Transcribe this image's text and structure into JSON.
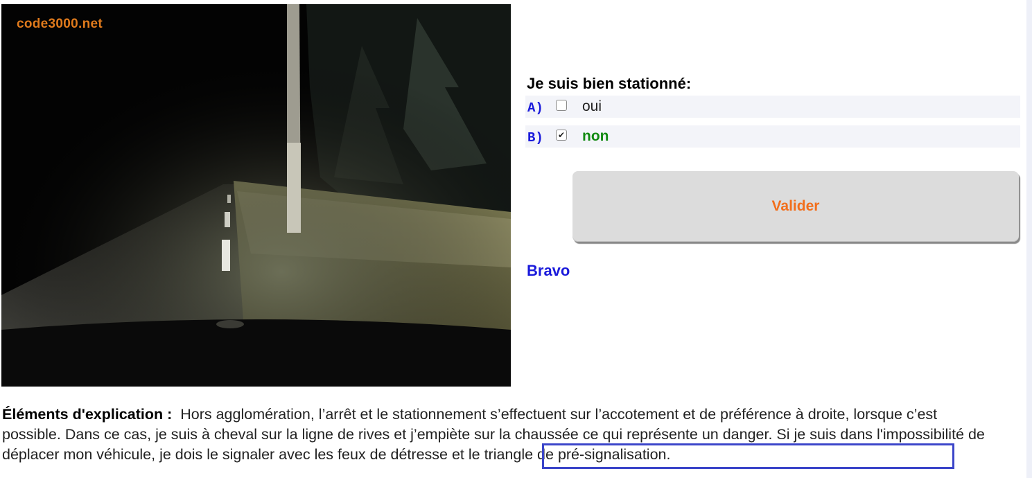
{
  "scene": {
    "watermark": "code3000.net",
    "image_description_icon": "night-road-scene-image"
  },
  "question": {
    "title": "Je suis bien stationné:",
    "answers": [
      {
        "letter": "A)",
        "text": "oui",
        "checked": false
      },
      {
        "letter": "B)",
        "text": "non",
        "checked": true
      }
    ]
  },
  "actions": {
    "validate_label": "Valider"
  },
  "result": {
    "text": "Bravo"
  },
  "explanation": {
    "label": "Éléments d'explication :",
    "text_before": "Hors agglomération, l’arrêt et le stationnement s’effectuent sur l’accotement et de préférence à droite, lorsque c’est possible. Dans ce cas, je suis à cheval sur la ligne de rives et j’empiète sur la chaussée ce qui représente un danger. Si je suis dans l'impossibilité de déplacer mon véhicule, je dois le signaler avec ",
    "highlighted": "les feux de détresse et le triangle de pré-signalisation."
  },
  "colors": {
    "accent_blue": "#1a1adb",
    "correct_green": "#128a12",
    "button_text_orange": "#f26e1b",
    "highlight_border": "#3b45c9"
  }
}
